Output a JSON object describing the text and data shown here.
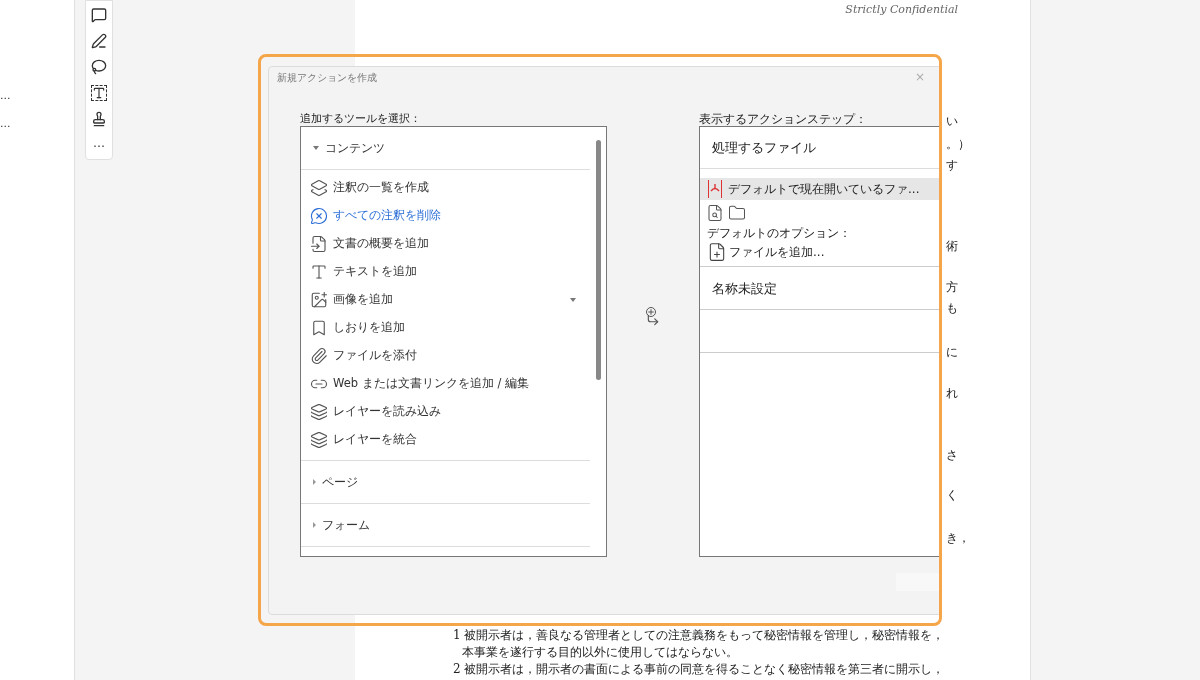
{
  "left_panel": {
    "items": [
      "...",
      "..."
    ]
  },
  "toolbar": {
    "more": "…"
  },
  "document": {
    "header": "Strictly Confidential",
    "fragments": [
      "い",
      "。）",
      "す",
      "術",
      "方",
      "も",
      "に",
      "れ",
      "さ",
      "く",
      "き，"
    ],
    "lines": [
      {
        "text": "1  被開示者は，善良なる管理者としての注意義務をもって秘密情報を管理し，秘密情報を，",
        "indent": false
      },
      {
        "text": "本事業を遂行する目的以外に使用してはならない。",
        "indent": true
      },
      {
        "text": "2  被開示者は，開示者の書面による事前の同意を得ることなく秘密情報を第三者に開示し，",
        "indent": false
      }
    ]
  },
  "dialog": {
    "title": "新規アクションを作成",
    "close": "×",
    "tools_label": "追加するツールを選択：",
    "tool_groups": [
      {
        "label": "コンテンツ",
        "expanded": true,
        "items": [
          {
            "label": "注釈の一覧を作成",
            "selected": false,
            "has_menu": false
          },
          {
            "label": "すべての注釈を削除",
            "selected": true,
            "has_menu": false
          },
          {
            "label": "文書の概要を追加",
            "selected": false,
            "has_menu": false
          },
          {
            "label": "テキストを追加",
            "selected": false,
            "has_menu": false
          },
          {
            "label": "画像を追加",
            "selected": false,
            "has_menu": true
          },
          {
            "label": "しおりを追加",
            "selected": false,
            "has_menu": false
          },
          {
            "label": "ファイルを添付",
            "selected": false,
            "has_menu": false
          },
          {
            "label": "Web または文書リンクを追加 / 編集",
            "selected": false,
            "has_menu": false
          },
          {
            "label": "レイヤーを読み込み",
            "selected": false,
            "has_menu": false
          },
          {
            "label": "レイヤーを統合",
            "selected": false,
            "has_menu": false
          }
        ]
      },
      {
        "label": "ページ",
        "expanded": false
      },
      {
        "label": "フォーム",
        "expanded": false
      }
    ],
    "steps_label": "表示するアクションステップ：",
    "steps": [
      {
        "kind": "files",
        "title": "処理するファイル",
        "file": "デフォルトで現在開いているファ...",
        "options_label": "デフォルトのオプション：",
        "add_file": "ファイルを追加..."
      },
      {
        "kind": "step",
        "title": "名称未設定"
      },
      {
        "kind": "empty"
      }
    ]
  }
}
